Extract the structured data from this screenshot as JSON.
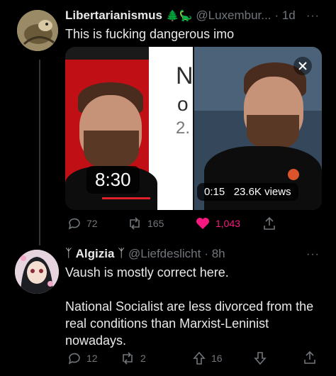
{
  "tweet1": {
    "name": "Libertarianismus",
    "name_emojis": "🌲🦕",
    "handle": "@Luxembur...",
    "time": "· 1d",
    "more": "···",
    "text": "This is fucking dangerous imo",
    "media": {
      "duration": "8:30",
      "letter_n": "N",
      "letter_o": "o",
      "letter_2": "2.",
      "video_time": "0:15",
      "views": "23.6K views"
    },
    "actions": {
      "replies": "72",
      "retweets": "165",
      "likes": "1,043"
    },
    "like_color": "#f91880"
  },
  "tweet2": {
    "name_prefix": "ᛉ",
    "name": "Algizia",
    "name_suffix": "ᛉ",
    "handle": "@Liefdeslicht",
    "time": "· 8h",
    "more": "···",
    "text_lines": [
      "Vaush is mostly correct here.",
      "",
      "National Socialist are less divorced from the",
      "real conditions than Marxist-Leninist",
      "nowadays."
    ],
    "actions": {
      "replies": "12",
      "retweets": "2",
      "upvotes": "16"
    }
  }
}
